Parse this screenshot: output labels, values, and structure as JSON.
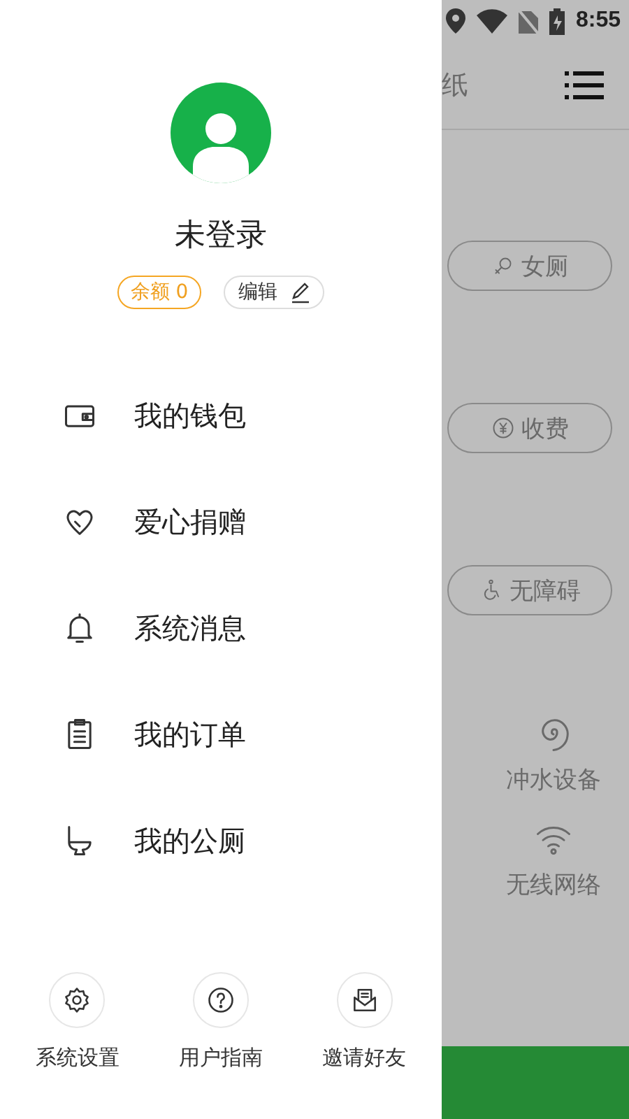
{
  "status_bar": {
    "time": "8:55"
  },
  "drawer": {
    "user": {
      "name": "未登录",
      "balance": "余额 0",
      "edit": "编辑"
    },
    "menu": [
      {
        "label": "我的钱包"
      },
      {
        "label": "爱心捐赠"
      },
      {
        "label": "系统消息"
      },
      {
        "label": "我的订单"
      },
      {
        "label": "我的公厕"
      }
    ],
    "footer": [
      {
        "label": "系统设置"
      },
      {
        "label": "用户指南"
      },
      {
        "label": "邀请好友"
      }
    ]
  },
  "background": {
    "header": "纸",
    "filters": [
      {
        "label": "女厕"
      },
      {
        "label": "收费"
      },
      {
        "label": "无障碍"
      }
    ],
    "features": [
      {
        "label": "冲水设备"
      },
      {
        "label": "无线网络"
      }
    ]
  }
}
